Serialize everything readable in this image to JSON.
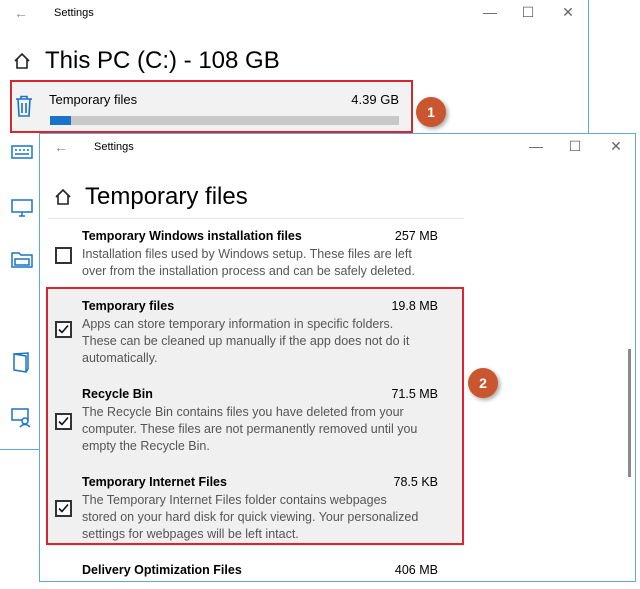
{
  "back_window": {
    "title": "Settings",
    "page_title": "This PC (C:) - 108 GB",
    "storage_item": {
      "label": "Temporary files",
      "size": "4.39 GB",
      "usage_fraction": 0.06
    }
  },
  "front_window": {
    "title": "Settings",
    "page_title": "Temporary files",
    "items": [
      {
        "title": "Temporary Windows installation files",
        "size": "257 MB",
        "checked": false,
        "desc_lines": [
          "Installation files used by Windows setup.  These files are left",
          "over from the installation process and can be safely deleted."
        ]
      },
      {
        "title": "Temporary files",
        "size": "19.8 MB",
        "checked": true,
        "desc_lines": [
          "Apps can store temporary information in specific folders.",
          "These can be cleaned up manually if the app does not do it",
          "automatically."
        ]
      },
      {
        "title": "Recycle Bin",
        "size": "71.5 MB",
        "checked": true,
        "desc_lines": [
          "The Recycle Bin contains files you have deleted from your",
          "computer. These files are not permanently removed until you",
          "empty the Recycle Bin."
        ]
      },
      {
        "title": "Temporary Internet Files",
        "size": "78.5 KB",
        "checked": true,
        "desc_lines": [
          "The Temporary Internet Files folder contains webpages",
          "stored on your hard disk for quick viewing. Your personalized",
          "settings for webpages will be left intact."
        ]
      },
      {
        "title": "Delivery Optimization Files",
        "size": "406 MB",
        "checked": false,
        "desc_lines": []
      }
    ]
  },
  "annotations": {
    "badge_1": "1",
    "badge_2": "2",
    "highlight_color": "#d9262e",
    "badge_color": "#c9562f"
  },
  "icons": {
    "back": "back-arrow-icon",
    "minimize": "minimize-icon",
    "maximize": "maximize-icon",
    "close": "close-icon",
    "home": "home-icon",
    "trash": "trash-icon"
  }
}
